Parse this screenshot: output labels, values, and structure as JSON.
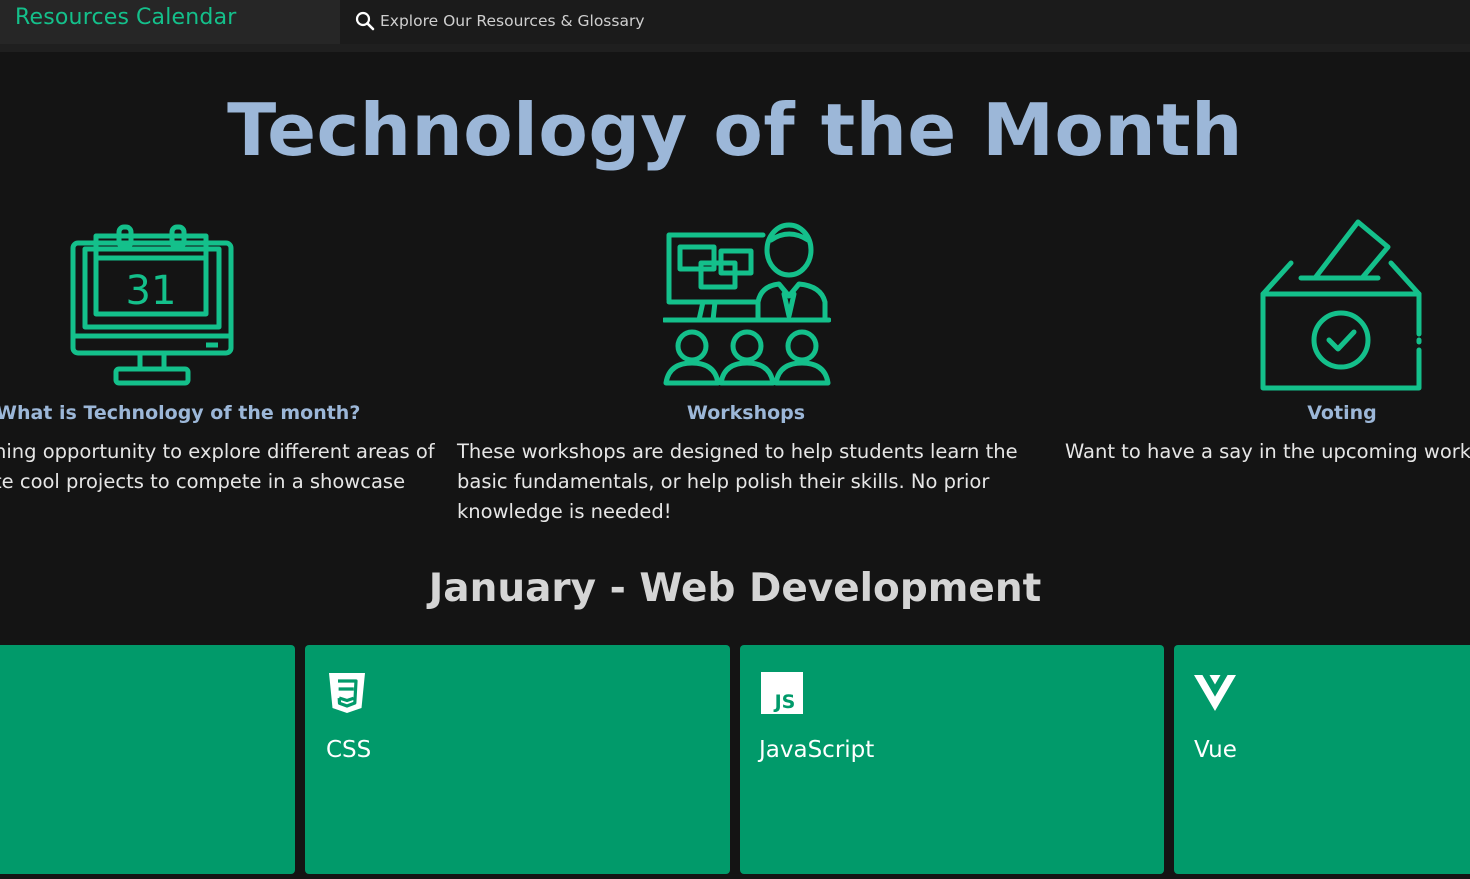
{
  "nav": {
    "links": [
      {
        "label": "Resources"
      },
      {
        "label": "Calendar"
      }
    ]
  },
  "search": {
    "placeholder": "Explore Our Resources & Glossary",
    "icon": "search-icon"
  },
  "hero": {
    "title": "Technology of the Month"
  },
  "features": [
    {
      "icon": "calendar-monitor-icon",
      "title": "What is Technology of the month?",
      "lines": [
        "ning opportunity to explore different areas of",
        "te cool projects to compete in a showcase"
      ]
    },
    {
      "icon": "workshop-presentation-icon",
      "title": "Workshops",
      "lines": [
        "These workshops are designed to help students learn the",
        "basic fundamentals, or help polish their skills. No prior",
        "knowledge is needed!"
      ]
    },
    {
      "icon": "ballot-box-icon",
      "title": "Voting",
      "lines": [
        "Want to have a say in the upcoming worksh"
      ]
    }
  ],
  "calendar_icon_day": "31",
  "month": {
    "title": "January - Web Development"
  },
  "cards": [
    {
      "label": "",
      "icon": ""
    },
    {
      "label": "CSS",
      "icon": "css3-icon"
    },
    {
      "label": "JavaScript",
      "icon": "javascript-icon",
      "icon_text": "JS"
    },
    {
      "label": "Vue",
      "icon": "vue-icon"
    }
  ],
  "colors": {
    "background": "#141414",
    "accent": "#14c08b",
    "heading": "#9cb7d8",
    "card": "#019a6a"
  }
}
